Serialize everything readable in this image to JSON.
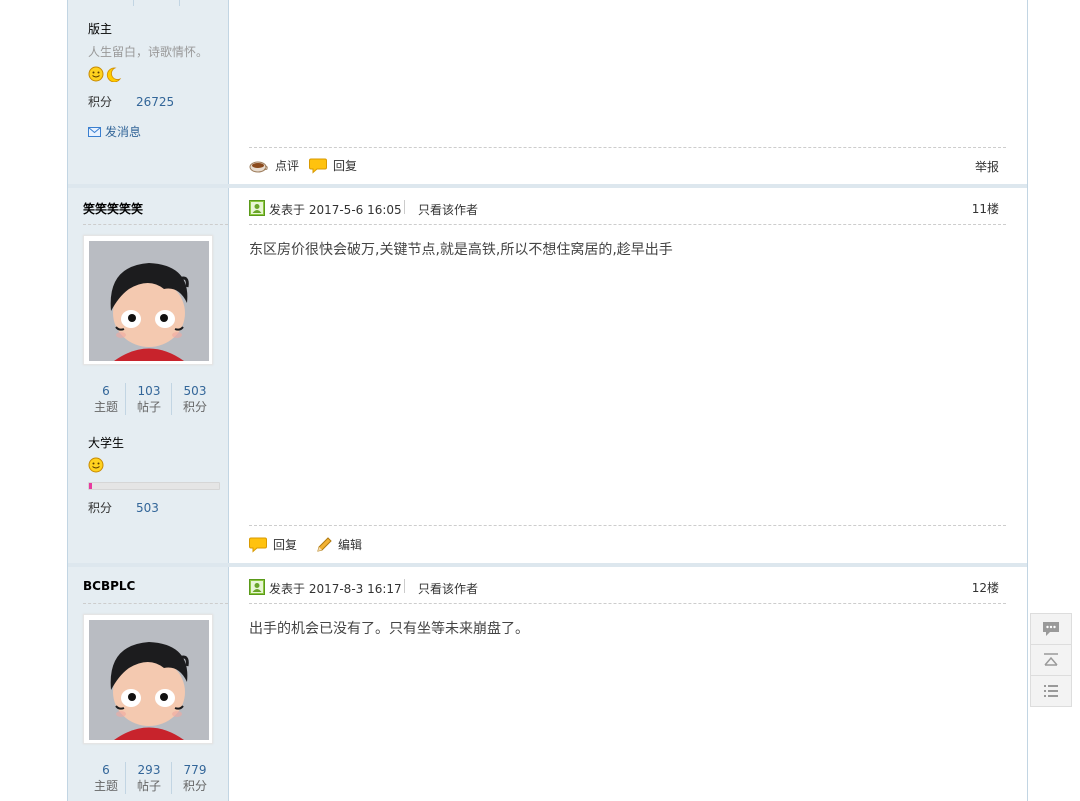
{
  "post_prev": {
    "rank": "版主",
    "signature": "人生留白，诗歌情怀。",
    "points_label": "积分",
    "points_value": "26725",
    "send_message": "发消息",
    "actions": {
      "comment": "点评",
      "reply": "回复",
      "report": "举报"
    }
  },
  "post11": {
    "username": "笑笑笑笑笑",
    "stats": [
      {
        "num": "6",
        "label": "主题"
      },
      {
        "num": "103",
        "label": "帖子"
      },
      {
        "num": "503",
        "label": "积分"
      }
    ],
    "rank": "大学生",
    "points_label": "积分",
    "points_value": "503",
    "progress_fraction": 0.02,
    "posted": "发表于 2017-5-6 16:05",
    "only_author": "只看该作者",
    "floor": "11楼",
    "content": "东区房价很快会破万,关键节点,就是高铁,所以不想住窝居的,趁早出手",
    "actions": {
      "reply": "回复",
      "edit": "编辑"
    }
  },
  "post12": {
    "username": "BCBPLC",
    "stats": [
      {
        "num": "6",
        "label": "主题"
      },
      {
        "num": "293",
        "label": "帖子"
      },
      {
        "num": "779",
        "label": "积分"
      }
    ],
    "posted": "发表于 2017-8-3 16:17",
    "only_author": "只看该作者",
    "floor": "12楼",
    "content": "出手的机会已没有了。只有坐等未来崩盘了。"
  },
  "colors": {
    "link": "#336699",
    "sidebar_bg": "#e5edf2",
    "border": "#c2d5e3",
    "progress": "#e83aa0"
  },
  "side_tools": [
    "comment-icon",
    "back-to-top-icon",
    "list-icon"
  ]
}
